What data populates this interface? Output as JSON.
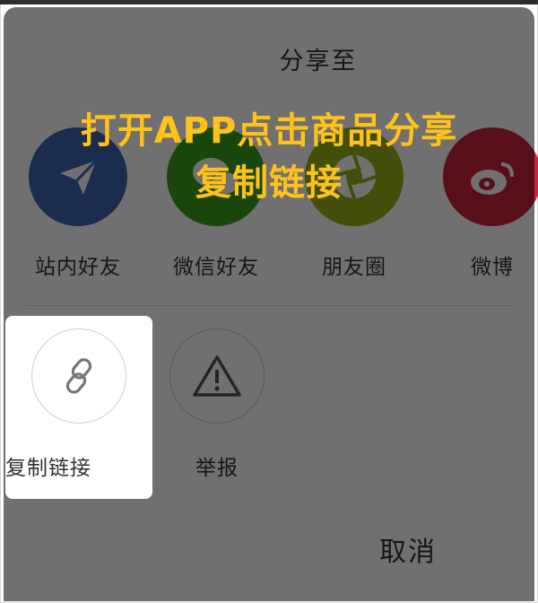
{
  "share_sheet": {
    "title": "分享至",
    "targets": [
      {
        "label": "站内好友",
        "icon": "paper-plane-icon",
        "color": "#3b66b3"
      },
      {
        "label": "微信好友",
        "icon": "wechat-icon",
        "color": "#3aa01a"
      },
      {
        "label": "朋友圈",
        "icon": "moments-icon",
        "color": "#9bb21a"
      },
      {
        "label": "微博",
        "icon": "weibo-icon",
        "color": "#c8243a"
      }
    ],
    "actions": [
      {
        "label": "复制链接",
        "icon": "link-icon"
      },
      {
        "label": "举报",
        "icon": "warning-icon"
      }
    ],
    "cancel_label": "取消"
  },
  "promo": {
    "line1": "打开APP点击商品分享",
    "line2": "复制链接",
    "color": "#ffc21a"
  }
}
